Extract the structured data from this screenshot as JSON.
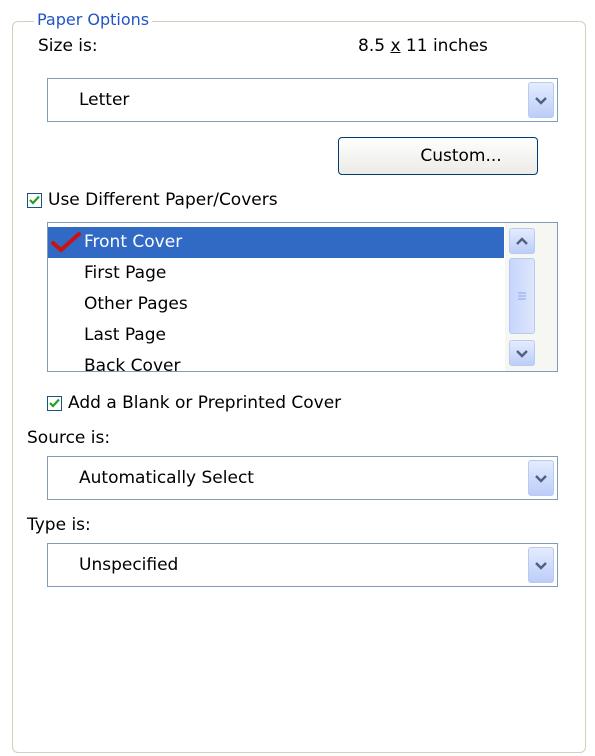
{
  "group": {
    "title": "Paper Options"
  },
  "size": {
    "label": "Size is:",
    "width": "8.5",
    "by": "x",
    "height_unit": " 11 inches",
    "combo_value": "Letter",
    "custom_button": "Custom..."
  },
  "use_different": {
    "label": "Use Different Paper/Covers",
    "checked": true
  },
  "pages_list": {
    "items": [
      {
        "label": "Front Cover",
        "selected": true,
        "checked": true
      },
      {
        "label": "First Page",
        "selected": false,
        "checked": false
      },
      {
        "label": "Other Pages",
        "selected": false,
        "checked": false
      },
      {
        "label": "Last Page",
        "selected": false,
        "checked": false
      },
      {
        "label": "Back Cover",
        "selected": false,
        "checked": false
      }
    ]
  },
  "blank_cover": {
    "label": "Add a Blank or Preprinted Cover",
    "checked": true
  },
  "source": {
    "label": "Source is:",
    "combo_value": "Automatically Select"
  },
  "type": {
    "label": "Type is:",
    "combo_value": "Unspecified"
  },
  "colors": {
    "group_title": "#1f55c4",
    "selection": "#316ac5",
    "check_green": "#21a121",
    "check_red": "#cc1111"
  },
  "icons": {
    "combo_arrow": "chevron-down-icon",
    "scroll_up": "chevron-up-icon",
    "scroll_down": "chevron-down-icon",
    "checkmark": "checkmark-icon"
  }
}
